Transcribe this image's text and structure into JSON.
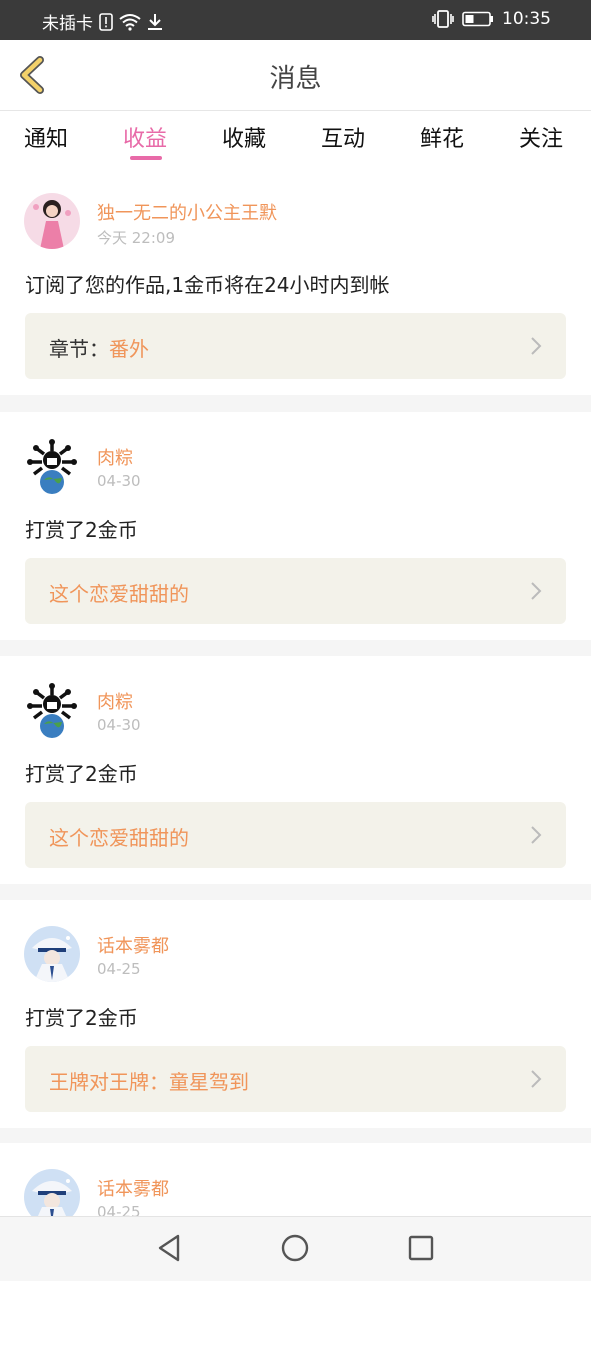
{
  "status_bar": {
    "carrier": "未插卡",
    "time": "10:35",
    "icons": [
      "sim-alert-icon",
      "wifi-icon",
      "download-icon",
      "vibrate-icon",
      "battery-icon"
    ]
  },
  "header": {
    "title": "消息",
    "back_icon": "chevron-left-icon"
  },
  "tabs": [
    {
      "label": "通知",
      "active": false
    },
    {
      "label": "收益",
      "active": true
    },
    {
      "label": "收藏",
      "active": false
    },
    {
      "label": "互动",
      "active": false
    },
    {
      "label": "鲜花",
      "active": false
    },
    {
      "label": "关注",
      "active": false
    }
  ],
  "messages": [
    {
      "user": "独一无二的小公主王默",
      "time": "今天 22:09",
      "text": "订阅了您的作品,1金币将在24小时内到帐",
      "ref_label": "章节：",
      "ref_value": "番外"
    },
    {
      "user": "肉粽",
      "time": "04-30",
      "text": "打赏了2金币",
      "ref_label": "",
      "ref_value": "这个恋爱甜甜的"
    },
    {
      "user": "肉粽",
      "time": "04-30",
      "text": "打赏了2金币",
      "ref_label": "",
      "ref_value": "这个恋爱甜甜的"
    },
    {
      "user": "话本雾都",
      "time": "04-25",
      "text": "打赏了2金币",
      "ref_label": "",
      "ref_value": "王牌对王牌：童星驾到"
    },
    {
      "user": "话本雾都",
      "time": "04-25"
    }
  ],
  "bottom_nav": {
    "icons": [
      "back-triangle-icon",
      "home-circle-icon",
      "recents-square-icon"
    ]
  },
  "colors": {
    "accent_pink": "#e86aa8",
    "accent_orange": "#f0955a",
    "back_arrow": "#f3d16a"
  }
}
